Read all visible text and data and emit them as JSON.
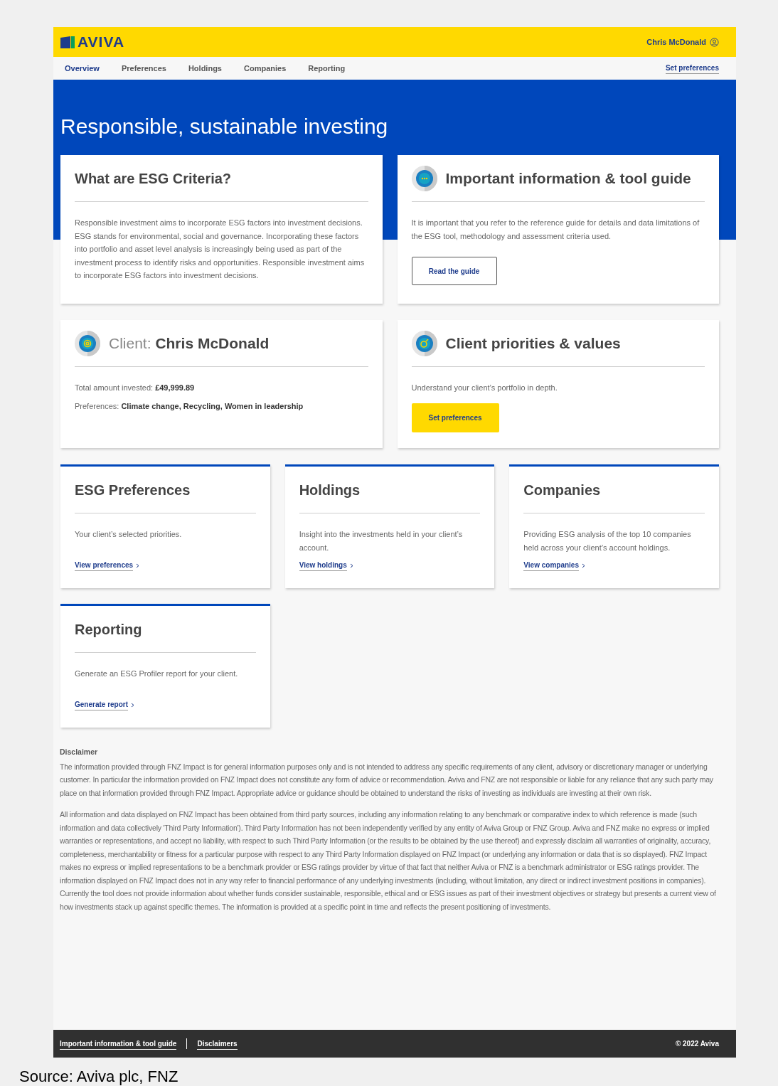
{
  "header": {
    "logo": "AVIVA",
    "user": "Chris McDonald"
  },
  "nav": {
    "items": [
      {
        "label": "Overview",
        "selected": true
      },
      {
        "label": "Preferences",
        "selected": false
      },
      {
        "label": "Holdings",
        "selected": false
      },
      {
        "label": "Companies",
        "selected": false
      },
      {
        "label": "Reporting",
        "selected": false
      }
    ],
    "action": "Set preferences"
  },
  "hero": {
    "title": "Responsible, sustainable investing"
  },
  "top_cards": [
    {
      "kind": "text",
      "title": "What are ESG Criteria?",
      "body": "Responsible investment aims to incorporate ESG factors into investment decisions. ESG stands for environmental, social and governance. Incorporating these factors into portfolio and asset level analysis is increasingly being used as part of the investment process to identify risks and opportunities. Responsible investment aims to incorporate ESG factors into investment decisions."
    },
    {
      "kind": "guide",
      "title": "Important information & tool guide",
      "body": "It is important that you refer to the reference guide for details and data limitations of the ESG tool, methodology and assessment criteria used.",
      "button": "Read the guide"
    },
    {
      "kind": "client",
      "title_prefix": "Client:",
      "title": "Chris McDonald",
      "lines": [
        "Total amount invested: **£49,999.89**",
        "Preferences: **Climate change, Recycling, Women in leadership**"
      ]
    },
    {
      "kind": "priorities",
      "title": "Client priorities & values",
      "body": "Understand your client’s portfolio in depth.",
      "button": "Set preferences"
    }
  ],
  "section_cards": [
    {
      "title": "ESG Preferences",
      "body": "Your client’s selected priorities.",
      "link": "View preferences"
    },
    {
      "title": "Holdings",
      "body": "Insight into the investments held in your client’s account.",
      "link": "View holdings"
    },
    {
      "title": "Companies",
      "body": "Providing ESG analysis of the top 10 companies held across your client’s account holdings.",
      "link": "View companies"
    },
    {
      "title": "Reporting",
      "body": "Generate an ESG Profiler report for your client.",
      "link": "Generate report"
    }
  ],
  "disclaimer": {
    "heading": "Disclaimer",
    "paragraphs": [
      "The information provided through FNZ Impact is for general information purposes only and is not intended to address any specific requirements of any client, advisory or discretionary manager or underlying customer. In particular the information provided on FNZ Impact does not constitute any form of advice or recommendation. Aviva and FNZ are not responsible or liable for any reliance that any such party may place on that information provided through FNZ Impact. Appropriate advice or guidance should be obtained to understand the risks of investing as individuals are investing at their own risk.",
      "All information and data displayed on FNZ Impact has been obtained from third party sources, including any information relating to any benchmark or comparative index to which reference is made (such information and data collectively 'Third Party Information'). Third Party Information has not been independently verified by any entity of Aviva Group or FNZ Group. Aviva and FNZ make no express or implied warranties or representations, and accept no liability, with respect to such Third Party Information (or the results to be obtained by the use thereof) and expressly disclaim all warranties of originality, accuracy, completeness, merchantability or fitness for a particular purpose with respect to any Third Party Information displayed on FNZ Impact (or underlying any information or data that is so displayed). FNZ Impact makes no express or implied representations to be a benchmark provider or ESG ratings provider by virtue of that fact that neither Aviva or FNZ is a benchmark administrator or ESG ratings provider. The information displayed on FNZ Impact does not in any way refer to financial performance of any underlying investments (including, without limitation, any direct or indirect investment positions in companies). Currently the tool does not provide information about whether funds consider sustainable, responsible, ethical and or ESG issues as part of their investment objectives or strategy but presents a current view of how investments stack up against specific themes. The information is provided at a specific point in time and reflects the present positioning of investments."
    ]
  },
  "footer": {
    "links": [
      "Important information & tool guide",
      "Disclaimers"
    ],
    "copyright": "© 2022 Aviva"
  },
  "caption": "Source: Aviva plc, FNZ"
}
